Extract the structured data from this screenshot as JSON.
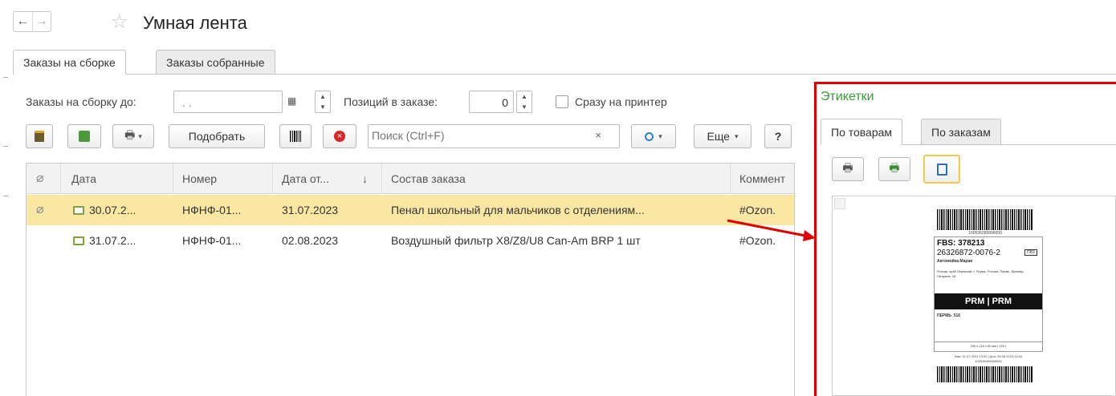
{
  "header": {
    "back": "←",
    "forward": "→",
    "title": "Умная лента"
  },
  "tabs": [
    {
      "label": "Заказы на сборке"
    },
    {
      "label": "Заказы собранные"
    }
  ],
  "filters": {
    "orders_until_label": "Заказы на сборку до:",
    "orders_until_value": ". .",
    "positions_label": "Позиций в заказе:",
    "positions_value": "0",
    "print_now_label": "Сразу на принтер"
  },
  "toolbar": {
    "pick_label": "Подобрать",
    "search_placeholder": "Поиск (Ctrl+F)",
    "more_label": "Еще",
    "help_label": "?",
    "clear_label": "×"
  },
  "table": {
    "columns": [
      "Дата",
      "Номер",
      "Дата от...",
      "Состав заказа",
      "Коммент"
    ],
    "rows": [
      {
        "date": "30.07.2...",
        "number": "НФНФ-01...",
        "ship_date": "31.07.2023",
        "content": "Пенал школьный для мальчиков с отделениям...",
        "comment": "#Ozon."
      },
      {
        "date": "31.07.2...",
        "number": "НФНФ-01...",
        "ship_date": "02.08.2023",
        "content": "Воздушный фильтр X8/Z8/U8 Can-Am BRP 1 шт",
        "comment": "#Ozon."
      }
    ]
  },
  "labels_panel": {
    "title": "Этикетки",
    "tabs": [
      {
        "label": "По товарам"
      },
      {
        "label": "По заказам"
      }
    ],
    "sticker": {
      "top_code": "100536099996000",
      "fbs": "FBS: 378213",
      "order": "26326872-0076-2",
      "badge": "ПВЗ",
      "name": "Автомойка Марая",
      "address": "Россия, край Пермский, г. Пермь, Россия, Пермь, бульвар Гагарина, 18",
      "route": "PRM | PRM",
      "point": "ПЕРМЬ_516",
      "dims": "200 x 115 x 50 мм | 120 г",
      "footer": "Изм: 31.07.2023 13:00 | Доп: 26.08.2023 16:00",
      "bottom_code": "100536099996000"
    }
  },
  "colors": {
    "accent_red": "#e00000",
    "row_highlight": "#fae7a4",
    "labels_title": "#3a9b3a"
  }
}
